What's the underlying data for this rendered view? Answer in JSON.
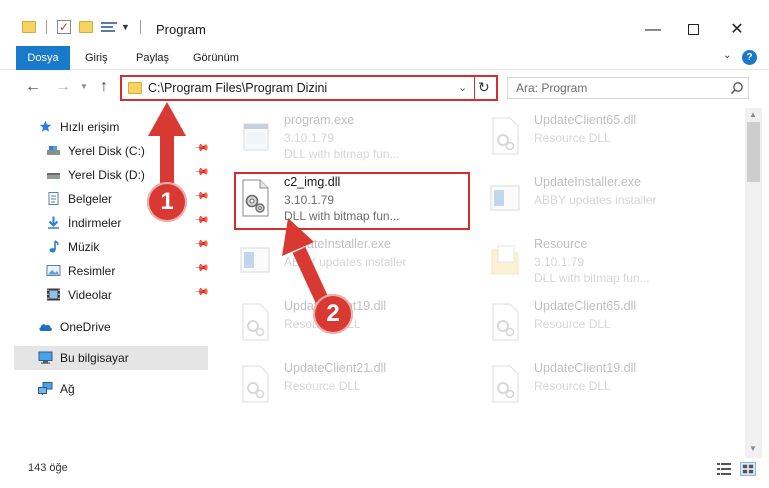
{
  "window": {
    "title": "Program",
    "minimize_glyph": "—",
    "close_glyph": "✕"
  },
  "ribbon": {
    "tabs": [
      "Dosya",
      "Giriş",
      "Paylaş",
      "Görünüm"
    ],
    "accent": "#1979ca"
  },
  "nav": {
    "address": "C:\\Program Files\\Program Dizini",
    "search_placeholder": "Ara: Program"
  },
  "sidebar": {
    "items": [
      {
        "label": "Hızlı erişim",
        "icon": "star-icon",
        "pinned": false
      },
      {
        "label": "Yerel Disk (C:)",
        "icon": "drive-icon",
        "pinned": true
      },
      {
        "label": "Yerel Disk (D:)",
        "icon": "drive-icon",
        "pinned": true
      },
      {
        "label": "Belgeler",
        "icon": "documents-icon",
        "pinned": true
      },
      {
        "label": "İndirmeler",
        "icon": "download-icon",
        "pinned": true
      },
      {
        "label": "Müzik",
        "icon": "music-icon",
        "pinned": true
      },
      {
        "label": "Resimler",
        "icon": "pictures-icon",
        "pinned": true
      },
      {
        "label": "Videolar",
        "icon": "video-icon",
        "pinned": true
      },
      {
        "label": "OneDrive",
        "icon": "cloud-icon",
        "pinned": false
      },
      {
        "label": "Bu bilgisayar",
        "icon": "computer-icon",
        "pinned": false,
        "selected": true
      },
      {
        "label": "Ağ",
        "icon": "network-icon",
        "pinned": false
      }
    ]
  },
  "files": [
    {
      "name": "program.exe",
      "line2": "3.10.1.79",
      "line3": "DLL with bitmap fun...",
      "icon": "exe-icon",
      "faded": true
    },
    {
      "name": "UpdateClient65.dll",
      "line2": "Resource DLL",
      "line3": "",
      "icon": "dll-icon",
      "faded": true
    },
    {
      "name": "c2_img.dll",
      "line2": "3.10.1.79",
      "line3": "DLL with bitmap fun...",
      "icon": "dll-gear-icon",
      "faded": false
    },
    {
      "name": "UpdateInstaller.exe",
      "line2": "ABBY updates installer",
      "line3": "",
      "icon": "installer-icon",
      "faded": true
    },
    {
      "name": "UpdateInstaller.exe",
      "line2": "ABBY updates installer",
      "line3": "",
      "icon": "installer-icon",
      "faded": true
    },
    {
      "name": "Resource",
      "line2": "3.10.1.79",
      "line3": "DLL with bitmap fun...",
      "icon": "folder-icon",
      "faded": true
    },
    {
      "name": "UpdateClient19.dll",
      "line2": "Resource DLL",
      "line3": "",
      "icon": "dll-icon",
      "faded": true
    },
    {
      "name": "UpdateClient65.dll",
      "line2": "Resource DLL",
      "line3": "",
      "icon": "dll-icon",
      "faded": true
    },
    {
      "name": "UpdateClient21.dll",
      "line2": "Resource DLL",
      "line3": "",
      "icon": "dll-icon",
      "faded": true
    },
    {
      "name": "UpdateClient19.dll",
      "line2": "Resource DLL",
      "line3": "",
      "icon": "dll-icon",
      "faded": true
    }
  ],
  "status": {
    "count": "143 öğe"
  },
  "callouts": [
    "1",
    "2"
  ],
  "colors": {
    "highlight": "#d62e2e",
    "callout": "#d83a33"
  }
}
